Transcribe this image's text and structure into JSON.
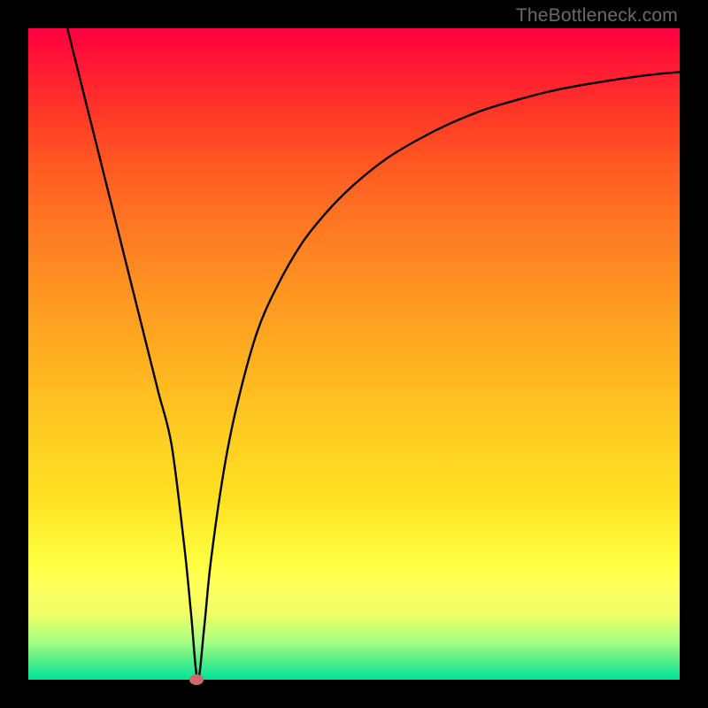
{
  "watermark": "TheBottleneck.com",
  "chart_data": {
    "type": "line",
    "title": "",
    "xlabel": "",
    "ylabel": "",
    "xlim": [
      0,
      100
    ],
    "ylim": [
      0,
      100
    ],
    "series": [
      {
        "name": "bottleneck-curve",
        "x": [
          6,
          8,
          10,
          12,
          14,
          16,
          18,
          20,
          22,
          24,
          25,
          26,
          27,
          28,
          30,
          32,
          35,
          38,
          42,
          46,
          50,
          55,
          60,
          65,
          70,
          75,
          80,
          85,
          90,
          95,
          100
        ],
        "values": [
          100,
          92,
          84,
          76,
          68,
          60,
          52,
          44,
          36,
          20,
          10,
          0,
          8,
          18,
          32,
          42,
          53,
          60,
          67,
          72,
          76,
          80,
          83,
          85.5,
          87.5,
          89,
          90.3,
          91.3,
          92.1,
          92.8,
          93.3
        ]
      }
    ],
    "marker": {
      "x": 25.8,
      "y": 0
    },
    "gradient_meaning": "good_at_bottom",
    "colors": {
      "top": "#ff0040",
      "bottom": "#00e599",
      "curve": "#000000",
      "marker": "#d06a6a"
    }
  }
}
